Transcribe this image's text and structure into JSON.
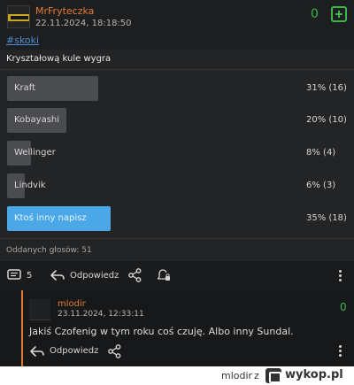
{
  "post": {
    "author": "MrFryteczka",
    "date": "22.11.2024, 18:18:50",
    "votes": "0",
    "tag": "#skoki"
  },
  "poll": {
    "title": "Kryształową kule wygra",
    "options": [
      {
        "label": "Kraft",
        "result": "31% (16)",
        "share": 31,
        "selected": false
      },
      {
        "label": "Kobayashi",
        "result": "20% (10)",
        "share": 20,
        "selected": false
      },
      {
        "label": "Wellinger",
        "result": "8% (4)",
        "share": 8,
        "selected": false
      },
      {
        "label": "Lindvik",
        "result": "6% (3)",
        "share": 6,
        "selected": false
      },
      {
        "label": "Ktoś inny napisz",
        "result": "35% (18)",
        "share": 35,
        "selected": true
      }
    ],
    "total": "Oddanych głosów: 51"
  },
  "actions": {
    "comments_count": "5",
    "reply_label": "Odpowiedz"
  },
  "comment": {
    "author": "mlodir",
    "date": "23.11.2024, 12:33:11",
    "votes": "0",
    "text": "Jakiś Czofenig w tym roku coś czuję. Albo inny Sundal.",
    "reply_label": "Odpowiedz"
  },
  "footer": {
    "user": "mlodir",
    "separator": "z",
    "site": "wykop.pl"
  },
  "colors": {
    "accent_orange": "#e47a33",
    "vote_green": "#3fb449",
    "link_blue": "#4a8fd6",
    "selected_bar": "#4aa8e9"
  },
  "icons": [
    "comments-icon",
    "reply-icon",
    "share-icon",
    "bell-lock-icon",
    "kebab-menu-icon",
    "plus-vote-icon"
  ]
}
